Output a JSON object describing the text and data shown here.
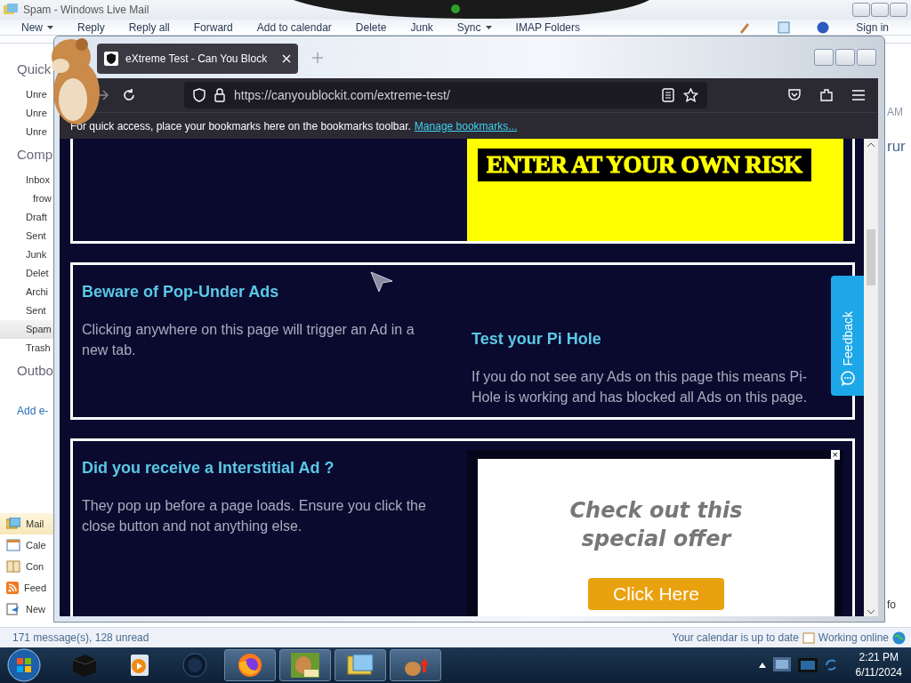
{
  "mail_window": {
    "title": "Spam - Windows Live Mail",
    "toolbar": [
      {
        "label": "New",
        "dropdown": true
      },
      {
        "label": "Reply",
        "dropdown": false
      },
      {
        "label": "Reply all",
        "dropdown": false
      },
      {
        "label": "Forward",
        "dropdown": false
      },
      {
        "label": "Add to calendar",
        "dropdown": false
      },
      {
        "label": "Delete",
        "dropdown": false
      },
      {
        "label": "Junk",
        "dropdown": false
      },
      {
        "label": "Sync",
        "dropdown": true
      },
      {
        "label": "IMAP Folders",
        "dropdown": false
      }
    ],
    "sign_in": "Sign in",
    "sidebar": [
      {
        "kind": "header",
        "label": "Quick"
      },
      {
        "kind": "folder",
        "label": "Unre",
        "selected": false
      },
      {
        "kind": "folder",
        "label": "Unre",
        "selected": false
      },
      {
        "kind": "folder",
        "label": "Unre",
        "selected": false
      },
      {
        "kind": "header",
        "label": "Comp"
      },
      {
        "kind": "folder",
        "label": "Inbox",
        "selected": false,
        "children": [
          {
            "kind": "folder",
            "label": "frow",
            "selected": false
          }
        ]
      },
      {
        "kind": "folder",
        "label": "Draft",
        "selected": false
      },
      {
        "kind": "folder",
        "label": "Sent",
        "selected": false
      },
      {
        "kind": "folder",
        "label": "Junk",
        "selected": false
      },
      {
        "kind": "folder",
        "label": "Delet",
        "selected": false
      },
      {
        "kind": "folder",
        "label": "Archi",
        "selected": false
      },
      {
        "kind": "folder",
        "label": "Sent",
        "selected": false
      },
      {
        "kind": "folder",
        "label": "Spam",
        "selected": true
      },
      {
        "kind": "folder",
        "label": "Trash",
        "selected": false
      },
      {
        "kind": "header",
        "label": "Outbo"
      },
      {
        "kind": "link",
        "label": "Add e-"
      }
    ],
    "nav": [
      {
        "kind": "mail",
        "label": "Mail",
        "selected": true
      },
      {
        "kind": "calendar",
        "label": "Cale",
        "selected": false
      },
      {
        "kind": "contacts",
        "label": "Con",
        "selected": false
      },
      {
        "kind": "feeds",
        "label": "Feed",
        "selected": false
      },
      {
        "kind": "news",
        "label": "New",
        "selected": false
      }
    ],
    "right_edge": [
      {
        "label": "AM"
      },
      {
        "label": "rur"
      },
      {
        "label": "fo"
      }
    ],
    "status_left": "171 message(s), 128 unread",
    "status_calendar": "Your calendar is up to date",
    "status_online": "Working online"
  },
  "browser": {
    "tab_title": "eXtreme Test - Can You Block",
    "url": "https://canyoublockit.com/extreme-test/",
    "bookmarks_hint": "For quick access, place your bookmarks here on the bookmarks toolbar.",
    "bookmarks_link": "Manage bookmarks...",
    "banner": "ENTER AT YOUR OWN RISK",
    "cards": [
      {
        "left_heading": "Beware of Pop-Under Ads",
        "left_text": "Clicking anywhere on this page will trigger an Ad in a new tab.",
        "right_heading": "Test your Pi Hole",
        "right_text": "If you do not see any Ads on this page this means Pi-Hole is working and has blocked all Ads on this page."
      },
      {
        "left_heading": "Did you receive a Interstitial Ad ?",
        "left_text": "They pop up before a page loads. Ensure you click the close button and not anything else.",
        "ad_close": "×",
        "ad_text": "Check out this special offer",
        "ad_button": "Click Here"
      }
    ],
    "feedback": "Feedback"
  },
  "taskbar": {
    "apps": [
      {
        "kind": "box",
        "selected": false
      },
      {
        "kind": "media",
        "selected": false
      },
      {
        "kind": "globe",
        "selected": false
      },
      {
        "kind": "firefox",
        "selected": true
      },
      {
        "kind": "hamster",
        "selected": true
      },
      {
        "kind": "mail",
        "selected": true
      },
      {
        "kind": "upload",
        "selected": true
      }
    ],
    "time": "2:21 PM",
    "date": "6/11/2024"
  }
}
